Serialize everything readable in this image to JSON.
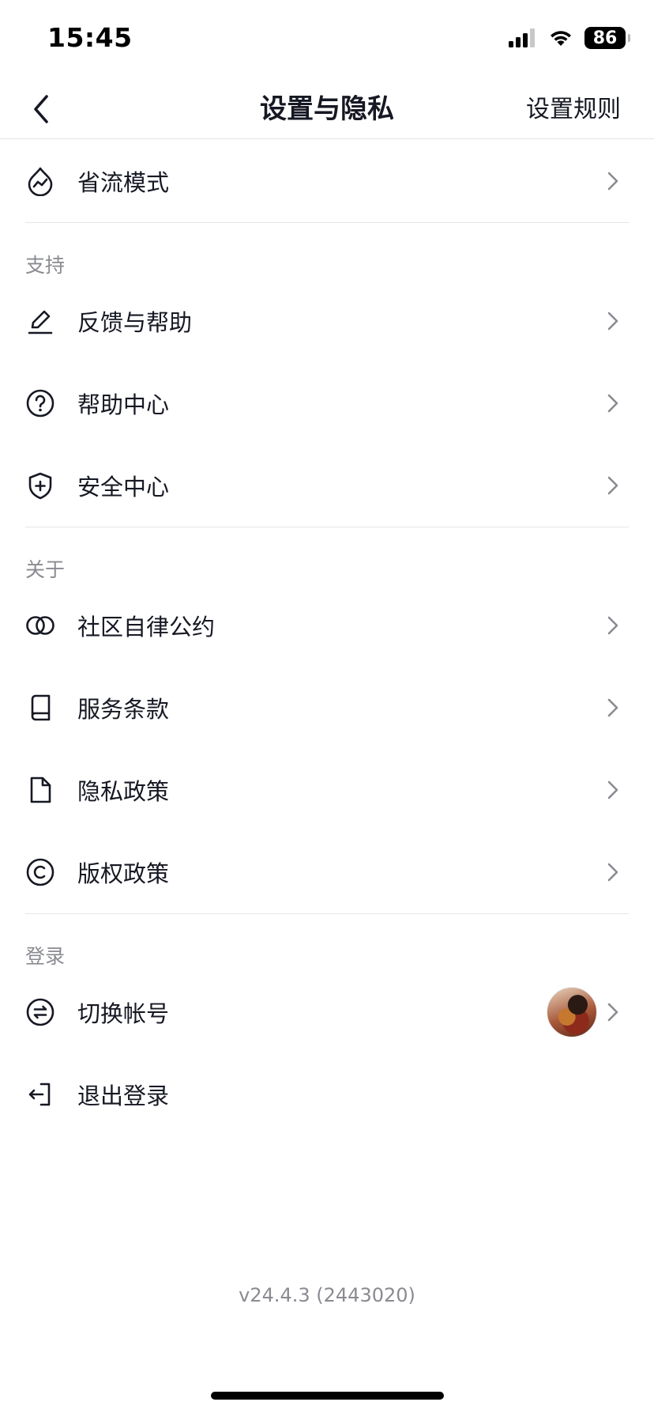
{
  "status": {
    "time": "15:45",
    "battery": "86"
  },
  "nav": {
    "title": "设置与隐私",
    "action": "设置规则"
  },
  "sections": {
    "top": [
      {
        "label": "省流模式",
        "icon": "data-saver-icon"
      }
    ],
    "support": {
      "header": "支持",
      "items": [
        {
          "label": "反馈与帮助",
          "icon": "pencil-icon"
        },
        {
          "label": "帮助中心",
          "icon": "question-circle-icon"
        },
        {
          "label": "安全中心",
          "icon": "shield-plus-icon"
        }
      ]
    },
    "about": {
      "header": "关于",
      "items": [
        {
          "label": "社区自律公约",
          "icon": "overlapping-circles-icon"
        },
        {
          "label": "服务条款",
          "icon": "book-icon"
        },
        {
          "label": "隐私政策",
          "icon": "document-icon"
        },
        {
          "label": "版权政策",
          "icon": "copyright-icon"
        }
      ]
    },
    "login": {
      "header": "登录",
      "items": [
        {
          "label": "切换帐号",
          "icon": "switch-account-icon"
        },
        {
          "label": "退出登录",
          "icon": "logout-icon"
        }
      ]
    }
  },
  "version": "v24.4.3 (2443020)"
}
